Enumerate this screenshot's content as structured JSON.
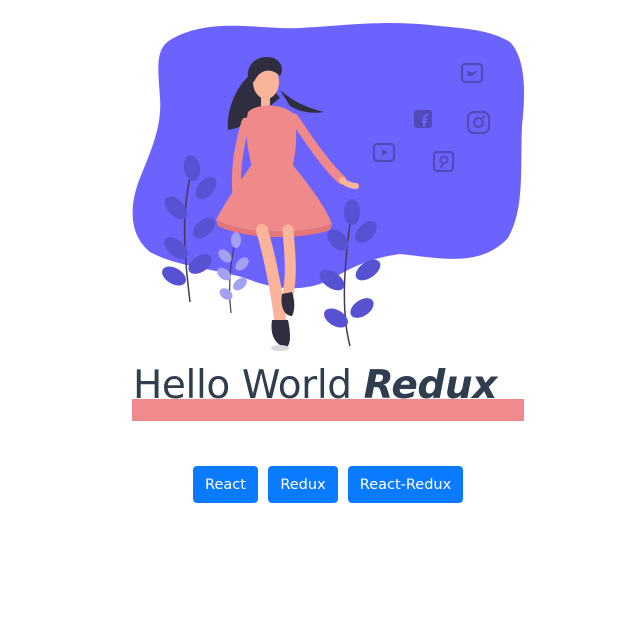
{
  "headline": {
    "text": "Hello World",
    "brand": "Redux"
  },
  "buttons": [
    {
      "label": "React"
    },
    {
      "label": "Redux"
    },
    {
      "label": "React-Redux"
    }
  ],
  "illustration": {
    "blob_color": "#6c63ff",
    "skin_color": "#f9b499",
    "dress_color": "#f08a8a",
    "hair_color": "#2f2e41",
    "plant_color": "#5752d1",
    "icon_color": "#514bb7",
    "social_icons": [
      "twitter-icon",
      "facebook-icon",
      "instagram-icon",
      "youtube-icon",
      "pinterest-icon"
    ]
  },
  "colors": {
    "underline": "#ef8a8d",
    "headline": "#2f3d4f",
    "button": "#0a7bff"
  }
}
